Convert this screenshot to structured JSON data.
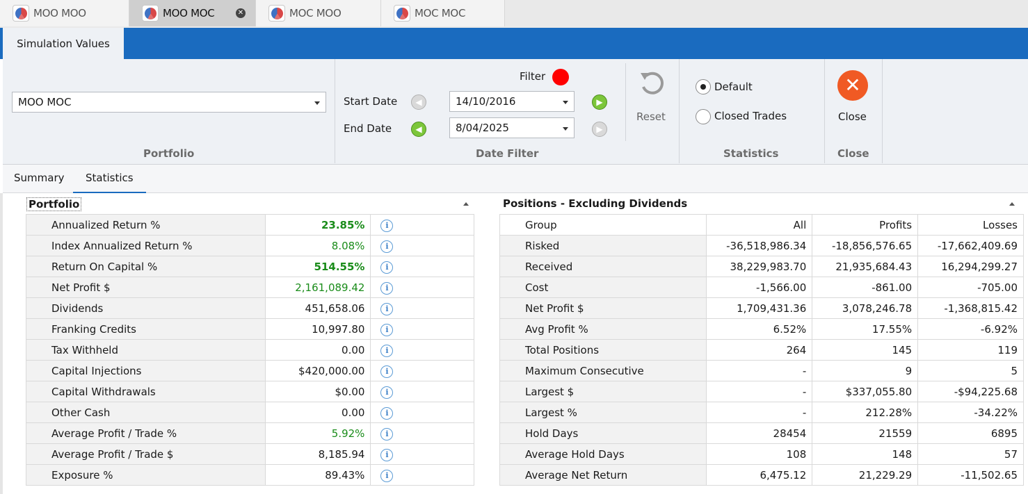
{
  "doc_tabs": [
    {
      "label": "MOO MOO",
      "active": false
    },
    {
      "label": "MOO MOC",
      "active": true
    },
    {
      "label": "MOC MOO",
      "active": false
    },
    {
      "label": "MOC MOC",
      "active": false
    }
  ],
  "ribbon": {
    "tab": "Simulation Values",
    "portfolio": {
      "value": "MOO MOC",
      "group_title": "Portfolio"
    },
    "date_filter": {
      "filter_label": "Filter",
      "start_label": "Start Date",
      "start_value": "14/10/2016",
      "end_label": "End Date",
      "end_value": "8/04/2025",
      "reset_label": "Reset",
      "group_title": "Date Filter"
    },
    "statistics": {
      "option_default": "Default",
      "option_closed": "Closed Trades",
      "group_title": "Statistics"
    },
    "close": {
      "button_label": "Close",
      "group_title": "Close"
    }
  },
  "subtabs": {
    "summary": "Summary",
    "statistics": "Statistics"
  },
  "portfolio_panel": {
    "title": "Portfolio",
    "rows": [
      {
        "label": "Annualized Return %",
        "value": "23.85%"
      },
      {
        "label": "Index Annualized Return %",
        "value": "8.08%"
      },
      {
        "label": "Return On Capital %",
        "value": "514.55%"
      },
      {
        "label": "Net Profit $",
        "value": "2,161,089.42"
      },
      {
        "label": "Dividends",
        "value": "451,658.06"
      },
      {
        "label": "Franking Credits",
        "value": "10,997.80"
      },
      {
        "label": "Tax Withheld",
        "value": "0.00"
      },
      {
        "label": "Capital Injections",
        "value": "$420,000.00"
      },
      {
        "label": "Capital Withdrawals",
        "value": "$0.00"
      },
      {
        "label": "Other Cash",
        "value": "0.00"
      },
      {
        "label": "Average Profit / Trade %",
        "value": "5.92%"
      },
      {
        "label": "Average Profit / Trade $",
        "value": "8,185.94"
      },
      {
        "label": "Exposure %",
        "value": "89.43%"
      }
    ]
  },
  "positions_panel": {
    "title": "Positions - Excluding Dividends",
    "header": {
      "group": "Group",
      "all": "All",
      "profits": "Profits",
      "losses": "Losses"
    },
    "rows": [
      {
        "label": "Risked",
        "all": "-36,518,986.34",
        "profits": "-18,856,576.65",
        "losses": "-17,662,409.69"
      },
      {
        "label": "Received",
        "all": "38,229,983.70",
        "profits": "21,935,684.43",
        "losses": "16,294,299.27"
      },
      {
        "label": "Cost",
        "all": "-1,566.00",
        "profits": "-861.00",
        "losses": "-705.00"
      },
      {
        "label": "Net Profit $",
        "all": "1,709,431.36",
        "profits": "3,078,246.78",
        "losses": "-1,368,815.42"
      },
      {
        "label": "Avg Profit %",
        "all": "6.52%",
        "profits": "17.55%",
        "losses": "-6.92%"
      },
      {
        "label": "Total Positions",
        "all": "264",
        "profits": "145",
        "losses": "119"
      },
      {
        "label": "Maximum Consecutive",
        "all": "-",
        "profits": "9",
        "losses": "5"
      },
      {
        "label": "Largest $",
        "all": "-",
        "profits": "$337,055.80",
        "losses": "-$94,225.68"
      },
      {
        "label": "Largest %",
        "all": "-",
        "profits": "212.28%",
        "losses": "-34.22%"
      },
      {
        "label": "Hold Days",
        "all": "28454",
        "profits": "21559",
        "losses": "6895"
      },
      {
        "label": "Average Hold Days",
        "all": "108",
        "profits": "148",
        "losses": "57"
      },
      {
        "label": "Average Net Return",
        "all": "6,475.12",
        "profits": "21,229.29",
        "losses": "-11,502.65"
      }
    ]
  },
  "colors": {
    "accent": "#1a6bbf",
    "positive": "#1a8c1a",
    "filter_dot": "#ff0000",
    "close_icon": "#f05a24",
    "nav_green": "#7cc63a"
  }
}
